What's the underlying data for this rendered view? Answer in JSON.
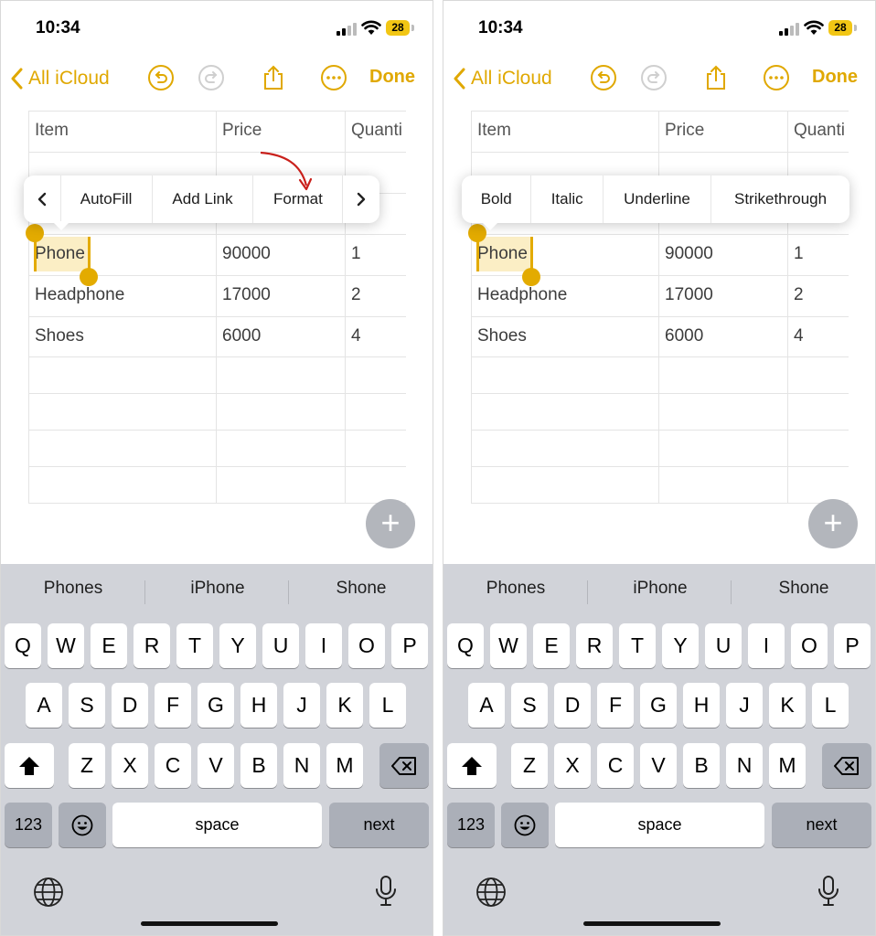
{
  "colors": {
    "accent": "#e0a800",
    "selection": "#fbeec5",
    "annotation_arrow": "#c9201b"
  },
  "status_bar": {
    "time": "10:34",
    "battery": "28"
  },
  "nav": {
    "back_label": "All iCloud",
    "done_label": "Done"
  },
  "table": {
    "headers": [
      "Item",
      "Price",
      "Quanti"
    ],
    "rows": [
      [
        "Phone",
        "90000",
        "1"
      ],
      [
        "Headphone",
        "17000",
        "2"
      ],
      [
        "Shoes",
        "6000",
        "4"
      ]
    ]
  },
  "selected_text": "Phone",
  "left_menu": {
    "items": [
      "AutoFill",
      "Add Link",
      "Format"
    ]
  },
  "right_menu": {
    "items": [
      "Bold",
      "Italic",
      "Underline",
      "Strikethrough"
    ]
  },
  "suggestions": [
    "Phones",
    "iPhone",
    "Shone"
  ],
  "keyboard": {
    "row1": [
      "Q",
      "W",
      "E",
      "R",
      "T",
      "Y",
      "U",
      "I",
      "O",
      "P"
    ],
    "row2": [
      "A",
      "S",
      "D",
      "F",
      "G",
      "H",
      "J",
      "K",
      "L"
    ],
    "row3": [
      "Z",
      "X",
      "C",
      "V",
      "B",
      "N",
      "M"
    ],
    "numbers_label": "123",
    "space_label": "space",
    "next_label": "next"
  }
}
